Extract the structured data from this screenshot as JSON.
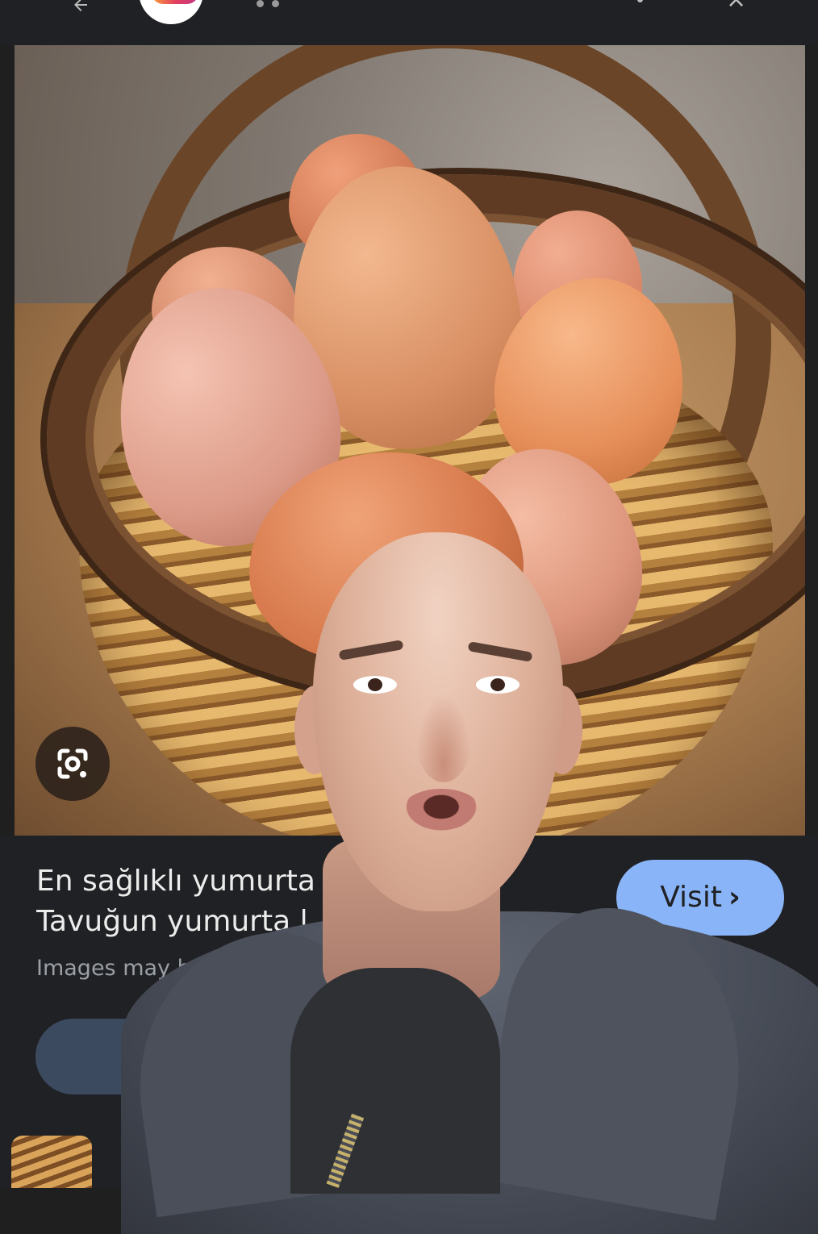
{
  "top_bar": {
    "back_icon": "back-arrow-icon",
    "app_icon": "instagram-logo-icon",
    "more_icon": "more-vert-icon",
    "close_icon": "close-icon"
  },
  "image_viewer": {
    "subject": "eggs in wicker basket",
    "lens_icon": "google-lens-icon"
  },
  "result": {
    "title_line1": "En sağlıklı yumurta re",
    "title_line2": "Tavuğun yumurta l",
    "disclaimer": "Images may be s",
    "visit_label": "Visit",
    "visit_chevron": "›",
    "accent_color": "#8ab4f8"
  },
  "overlay": {
    "type": "presenter-cutout"
  }
}
